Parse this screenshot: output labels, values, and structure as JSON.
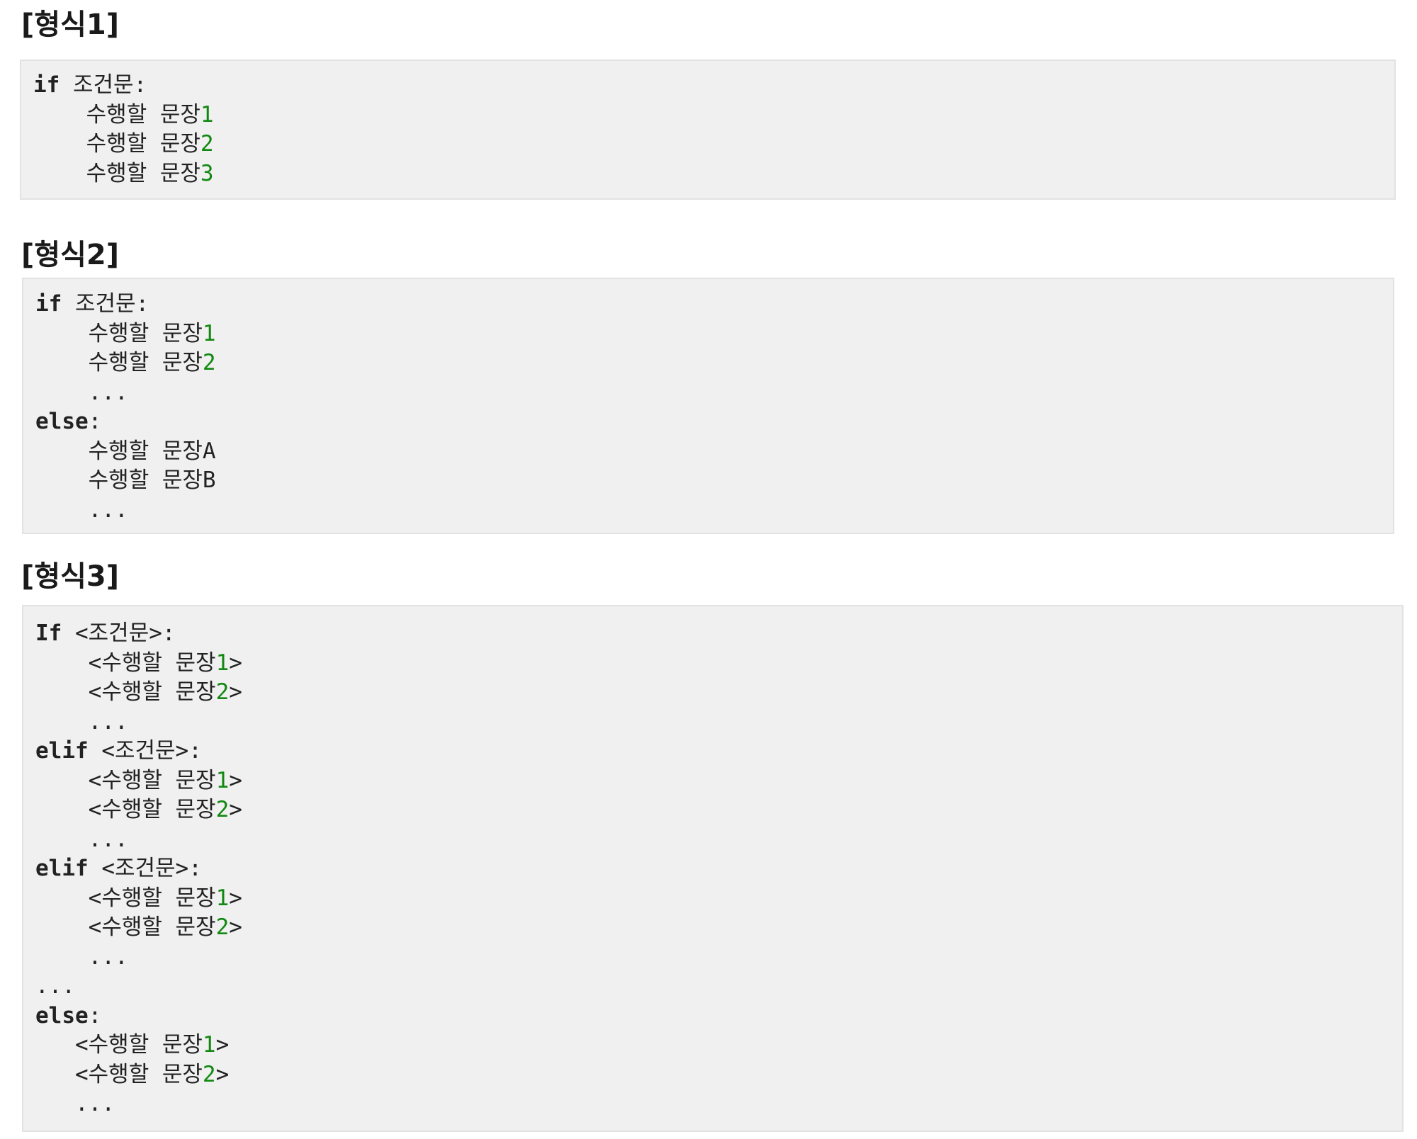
{
  "sections": [
    {
      "title": "[형식1]",
      "lines": [
        [
          {
            "t": "if",
            "c": "kw"
          },
          {
            "t": " 조건문:",
            "c": ""
          }
        ],
        [
          {
            "t": "    수행할 문장",
            "c": ""
          },
          {
            "t": "1",
            "c": "num"
          }
        ],
        [
          {
            "t": "    수행할 문장",
            "c": ""
          },
          {
            "t": "2",
            "c": "num"
          }
        ],
        [
          {
            "t": "    수행할 문장",
            "c": ""
          },
          {
            "t": "3",
            "c": "num"
          }
        ]
      ]
    },
    {
      "title": "[형식2]",
      "lines": [
        [
          {
            "t": "if",
            "c": "kw"
          },
          {
            "t": " 조건문:",
            "c": ""
          }
        ],
        [
          {
            "t": "    수행할 문장",
            "c": ""
          },
          {
            "t": "1",
            "c": "num"
          }
        ],
        [
          {
            "t": "    수행할 문장",
            "c": ""
          },
          {
            "t": "2",
            "c": "num"
          }
        ],
        [
          {
            "t": "    ...",
            "c": ""
          }
        ],
        [
          {
            "t": "else",
            "c": "kw"
          },
          {
            "t": ":",
            "c": ""
          }
        ],
        [
          {
            "t": "    수행할 문장A",
            "c": ""
          }
        ],
        [
          {
            "t": "    수행할 문장B",
            "c": ""
          }
        ],
        [
          {
            "t": "    ...",
            "c": ""
          }
        ]
      ]
    },
    {
      "title": "[형식3]",
      "lines": [
        [
          {
            "t": "If",
            "c": "kw"
          },
          {
            "t": " <조건문>:",
            "c": ""
          }
        ],
        [
          {
            "t": "    <수행할 문장",
            "c": ""
          },
          {
            "t": "1",
            "c": "num"
          },
          {
            "t": ">",
            "c": ""
          }
        ],
        [
          {
            "t": "    <수행할 문장",
            "c": ""
          },
          {
            "t": "2",
            "c": "num"
          },
          {
            "t": ">",
            "c": ""
          }
        ],
        [
          {
            "t": "    ...",
            "c": ""
          }
        ],
        [
          {
            "t": "elif",
            "c": "kw"
          },
          {
            "t": " <조건문>:",
            "c": ""
          }
        ],
        [
          {
            "t": "    <수행할 문장",
            "c": ""
          },
          {
            "t": "1",
            "c": "num"
          },
          {
            "t": ">",
            "c": ""
          }
        ],
        [
          {
            "t": "    <수행할 문장",
            "c": ""
          },
          {
            "t": "2",
            "c": "num"
          },
          {
            "t": ">",
            "c": ""
          }
        ],
        [
          {
            "t": "    ...",
            "c": ""
          }
        ],
        [
          {
            "t": "elif",
            "c": "kw"
          },
          {
            "t": " <조건문>:",
            "c": ""
          }
        ],
        [
          {
            "t": "    <수행할 문장",
            "c": ""
          },
          {
            "t": "1",
            "c": "num"
          },
          {
            "t": ">",
            "c": ""
          }
        ],
        [
          {
            "t": "    <수행할 문장",
            "c": ""
          },
          {
            "t": "2",
            "c": "num"
          },
          {
            "t": ">",
            "c": ""
          }
        ],
        [
          {
            "t": "    ...",
            "c": ""
          }
        ],
        [
          {
            "t": "...",
            "c": ""
          }
        ],
        [
          {
            "t": "else",
            "c": "kw"
          },
          {
            "t": ":",
            "c": ""
          }
        ],
        [
          {
            "t": "   <수행할 문장",
            "c": ""
          },
          {
            "t": "1",
            "c": "num"
          },
          {
            "t": ">",
            "c": ""
          }
        ],
        [
          {
            "t": "   <수행할 문장",
            "c": ""
          },
          {
            "t": "2",
            "c": "num"
          },
          {
            "t": ">",
            "c": ""
          }
        ],
        [
          {
            "t": "   ...",
            "c": ""
          }
        ]
      ]
    }
  ]
}
